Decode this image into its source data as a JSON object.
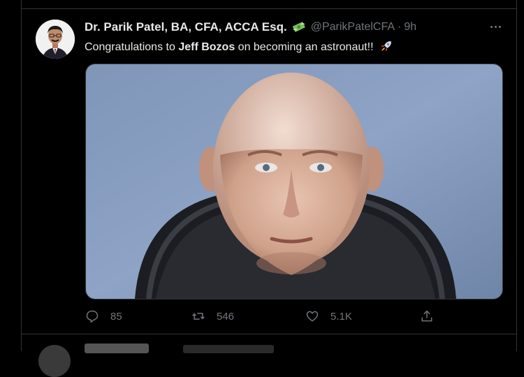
{
  "tweet": {
    "author_name": "Dr. Parik Patel, BA, CFA, ACCA Esq.",
    "handle": "@ParikPatelCFA",
    "separator": "·",
    "time": "9h",
    "text_prefix": "Congratulations to ",
    "text_bold": "Jeff Bozos",
    "text_suffix": " on becoming an astronaut!!",
    "name_emoji_icon": "money-with-wings-icon",
    "text_emoji_icon": "rocket-icon"
  },
  "actions": {
    "reply_count": "85",
    "retweet_count": "546",
    "like_count": "5.1K"
  },
  "colors": {
    "background": "#000000",
    "text_primary": "#e7e9ea",
    "text_secondary": "#71767b",
    "border": "#2f3336"
  }
}
